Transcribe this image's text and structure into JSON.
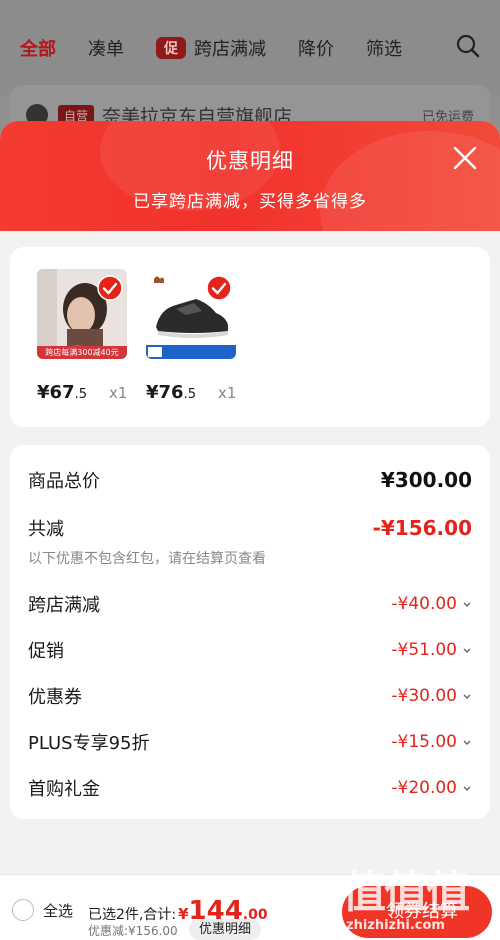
{
  "nav": {
    "tabs": [
      "全部",
      "凑单",
      "跨店满减",
      "降价",
      "筛选"
    ],
    "promo_tag": "促"
  },
  "store": {
    "tag": "自营",
    "name": "奈美拉京东自营旗舰店",
    "right": "已免运费"
  },
  "sheet": {
    "title": "优惠明细",
    "subtitle": "已享跨店满减，买得多省得多"
  },
  "products": [
    {
      "price_int": "¥67",
      "price_dec": ".5",
      "qty": "x1",
      "badge": "跨店每满300减40元"
    },
    {
      "price_int": "¥76",
      "price_dec": ".5",
      "qty": "x1"
    }
  ],
  "summary": {
    "total_label": "商品总价",
    "total_value": "¥300.00",
    "reduce_label": "共减",
    "reduce_value": "-¥156.00",
    "note": "以下优惠不包含红包，请在结算页查看",
    "items": [
      {
        "label": "跨店满减",
        "value": "-¥40.00"
      },
      {
        "label": "促销",
        "value": "-¥51.00"
      },
      {
        "label": "优惠券",
        "value": "-¥30.00"
      },
      {
        "label": "PLUS专享95折",
        "value": "-¥15.00"
      },
      {
        "label": "首购礼金",
        "value": "-¥20.00"
      }
    ]
  },
  "bottom": {
    "select_all": "全选",
    "selected_text": "已选2件,合计:",
    "yen": "¥",
    "amount_int": "144",
    "amount_dec": ".00",
    "discount_text": "优惠减:¥156.00",
    "detail_label": "优惠明细",
    "checkout_label": "领券结算"
  },
  "watermark": {
    "text": "值值值",
    "url": "zhizhizhi.com"
  },
  "colors": {
    "accent": "#e4241b",
    "header_red": "#f2322c"
  }
}
